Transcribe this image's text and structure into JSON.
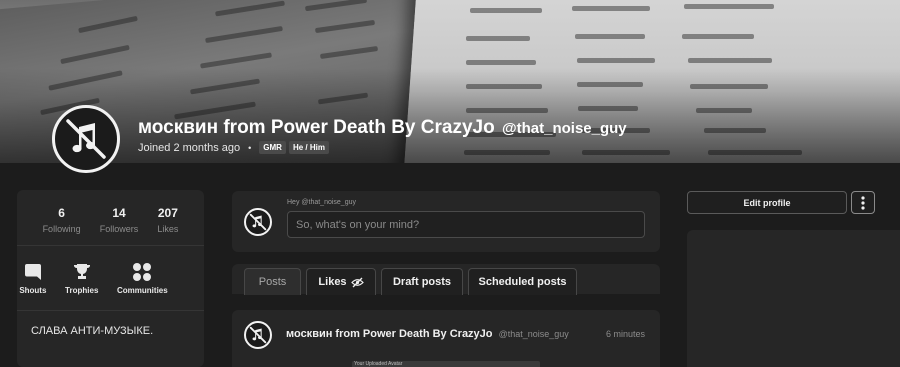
{
  "banner": {
    "display_name": "москвин from Power Death By CrazyJo",
    "handle": "@that_noise_guy",
    "joined": "Joined 2 months ago",
    "tags": [
      "GMR",
      "He / Him"
    ],
    "avatar_icon": "crossed-out-music-note-icon"
  },
  "stats": [
    {
      "value": "6",
      "label": "Following"
    },
    {
      "value": "14",
      "label": "Followers"
    },
    {
      "value": "207",
      "label": "Likes"
    }
  ],
  "nav": [
    {
      "label": "Shouts",
      "icon": "speech-bubble-icon"
    },
    {
      "label": "Trophies",
      "icon": "trophy-icon"
    },
    {
      "label": "Communities",
      "icon": "communities-icon"
    }
  ],
  "bio": "СЛАВА АНТИ-МУЗЫКЕ.",
  "composer": {
    "greeting": "Hey @that_noise_guy",
    "placeholder": "So, what's on your mind?"
  },
  "tabs": [
    {
      "label": "Posts",
      "active": true
    },
    {
      "label": "Likes",
      "icon": "eye-off-icon"
    },
    {
      "label": "Draft posts"
    },
    {
      "label": "Scheduled posts"
    }
  ],
  "post": {
    "author": "москвин from Power Death By CrazyJo",
    "handle": "@that_noise_guy",
    "time": "6 minutes",
    "attachment_label": "Your Uploaded Avatar"
  },
  "actions": {
    "edit_profile": "Edit profile",
    "more_icon": "vertical-ellipsis-icon"
  },
  "colors": {
    "background": "#1c1c1c",
    "card": "#262626",
    "muted_text": "#8c8c8c"
  }
}
